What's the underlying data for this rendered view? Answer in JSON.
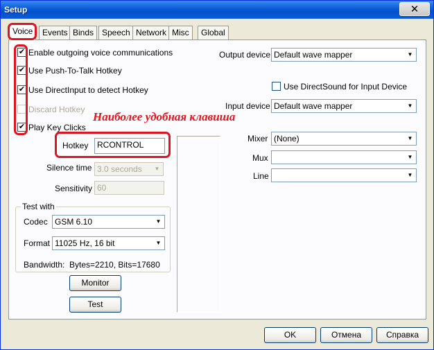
{
  "window": {
    "title": "Setup",
    "close_glyph": "✕"
  },
  "tabs": [
    "Voice",
    "Events",
    "Binds",
    "Speech",
    "Network",
    "Misc",
    "Global"
  ],
  "voice": {
    "checkboxes": [
      {
        "label": "Enable outgoing voice communications",
        "checked": true
      },
      {
        "label": "Use Push-To-Talk Hotkey",
        "checked": true
      },
      {
        "label": "Use DirectInput to detect Hotkey",
        "checked": true
      },
      {
        "label": "Discard Hotkey",
        "checked": false,
        "disabled": true
      },
      {
        "label": "Play Key Clicks",
        "checked": true
      }
    ],
    "check_glyph": "✔",
    "hotkey": {
      "label": "Hotkey",
      "value": "RCONTROL"
    },
    "silence": {
      "label": "Silence time",
      "value": "3.0 seconds"
    },
    "sensitivity": {
      "label": "Sensitivity",
      "value": "60"
    },
    "test_with": {
      "title": "Test with",
      "codec_label": "Codec",
      "codec_value": "GSM 6.10",
      "format_label": "Format",
      "format_value": "11025 Hz, 16 bit",
      "bandwidth_label": "Bandwidth:",
      "bandwidth_value": "Bytes=2210, Bits=17680"
    },
    "monitor_button": "Monitor",
    "test_button": "Test",
    "output_device": {
      "label": "Output device",
      "value": "Default wave mapper"
    },
    "directsound": {
      "label": "Use DirectSound for Input Device",
      "checked": false
    },
    "input_device": {
      "label": "Input device",
      "value": "Default wave mapper"
    },
    "mixer": {
      "label": "Mixer",
      "value": "(None)"
    },
    "mux": {
      "label": "Mux",
      "value": ""
    },
    "line": {
      "label": "Line",
      "value": ""
    },
    "annotation": "Наиболее удобная клавиша"
  },
  "footer": {
    "ok": "OK",
    "cancel": "Отмена",
    "help": "Справка"
  },
  "colors": {
    "annotation_red": "#e0141e",
    "title_blue": "#0a5bd8"
  }
}
